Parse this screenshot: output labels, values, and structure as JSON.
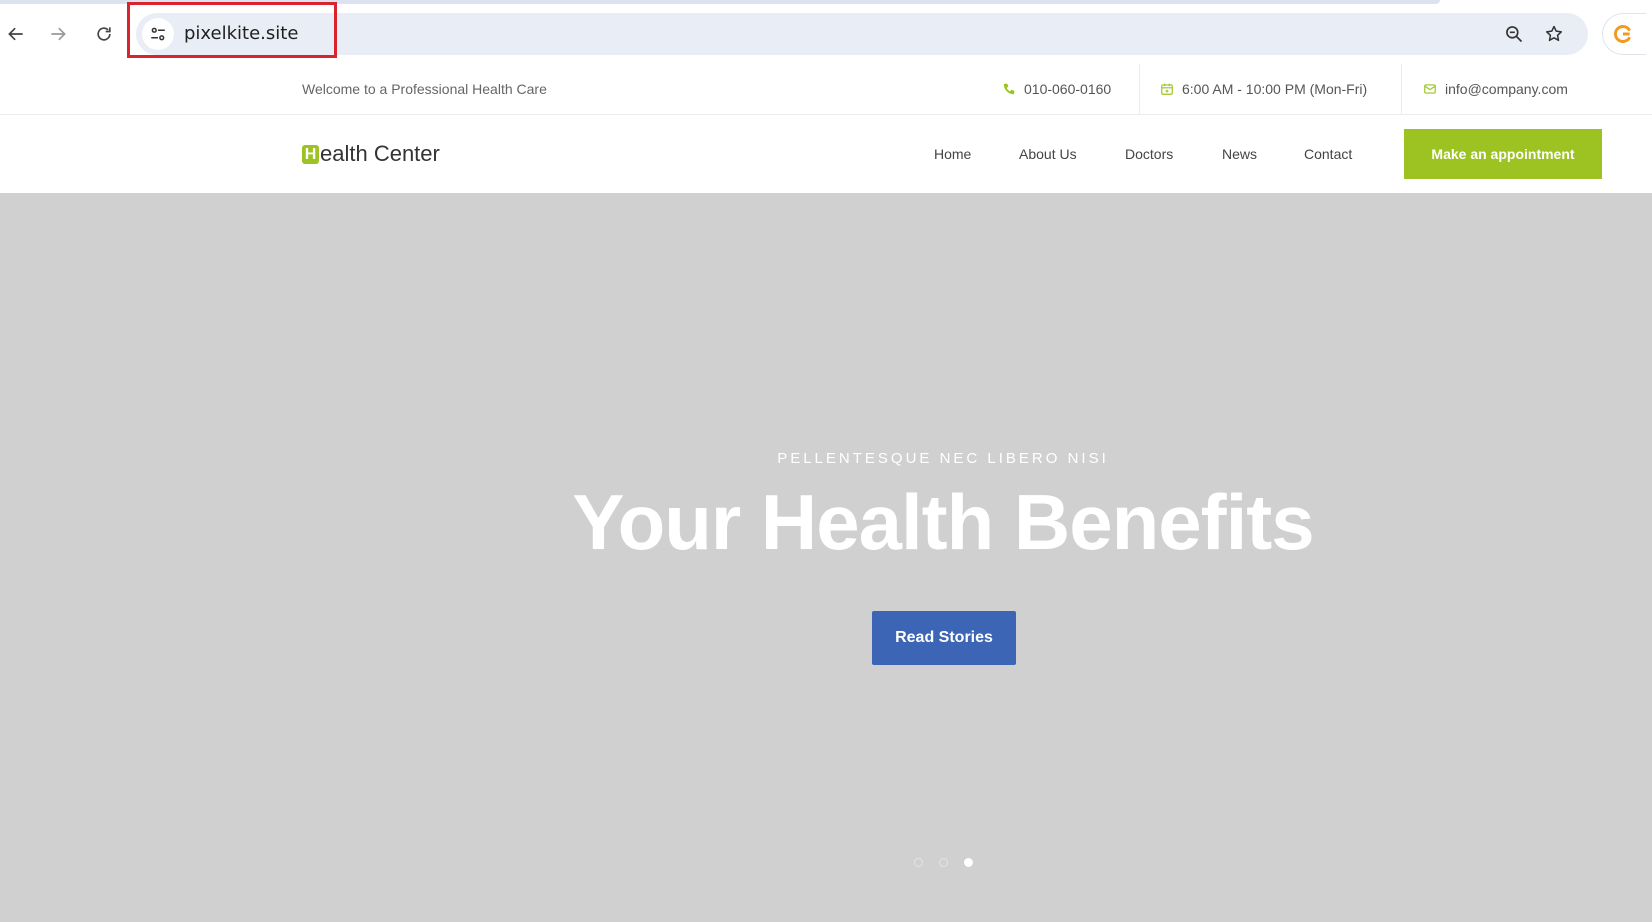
{
  "browser": {
    "url": "pixelkite.site",
    "icons": [
      "back-arrow-icon",
      "forward-arrow-icon",
      "reload-icon",
      "site-info-icon",
      "zoom-out-icon",
      "bookmark-star-icon",
      "extension-icon"
    ]
  },
  "topbar": {
    "welcome": "Welcome to a Professional Health Care",
    "phone": "010-060-0160",
    "hours": "6:00 AM - 10:00 PM (Mon-Fri)",
    "email": "info@company.com"
  },
  "navbar": {
    "logo_initial": "H",
    "logo_rest": "ealth Center",
    "links": [
      "Home",
      "About Us",
      "Doctors",
      "News",
      "Contact"
    ],
    "appointment_label": "Make an appointment"
  },
  "hero": {
    "kicker": "PELLENTESQUE NEC LIBERO NISI",
    "title": "Your Health Benefits",
    "button_label": "Read Stories",
    "slides_total": 3,
    "active_slide": 3
  },
  "colors": {
    "accent_green": "#9cc321",
    "button_blue": "#3d65b5",
    "hero_bg": "#d0d0d0",
    "highlight_red": "#d9232d"
  }
}
